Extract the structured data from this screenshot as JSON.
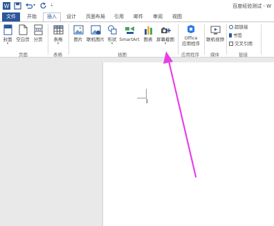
{
  "window": {
    "title": "百度经验测试 - W",
    "qat_icons": [
      "word-icon",
      "save-icon",
      "undo-icon",
      "redo-icon",
      "customize-icon"
    ]
  },
  "tabs": [
    {
      "label": "文件"
    },
    {
      "label": "开始"
    },
    {
      "label": "插入"
    },
    {
      "label": "设计"
    },
    {
      "label": "页面布局"
    },
    {
      "label": "引用"
    },
    {
      "label": "邮件"
    },
    {
      "label": "审阅"
    },
    {
      "label": "视图"
    }
  ],
  "active_tab": "插入",
  "ribbon": {
    "pages": {
      "cover": "封面",
      "blank": "空白页",
      "break": "分页",
      "group": "页面"
    },
    "tables": {
      "table": "表格",
      "group": "表格"
    },
    "illustrations": {
      "picture": "图片",
      "online_picture": "联机图片",
      "shapes": "形状",
      "smartart": "SmartArt",
      "chart": "图表",
      "screenshot": "屏幕截图",
      "group": "插图"
    },
    "apps": {
      "office_line1": "Office",
      "office_line2": "应用程序",
      "group": "应用程序"
    },
    "media": {
      "online_video": "联机视频",
      "group": "媒体"
    },
    "links": {
      "hyperlink": "超链接",
      "bookmark": "书签",
      "crossref": "交叉引用",
      "group": "链接"
    }
  },
  "colors": {
    "accent": "#2b579a",
    "arrow": "#e83ee8"
  }
}
